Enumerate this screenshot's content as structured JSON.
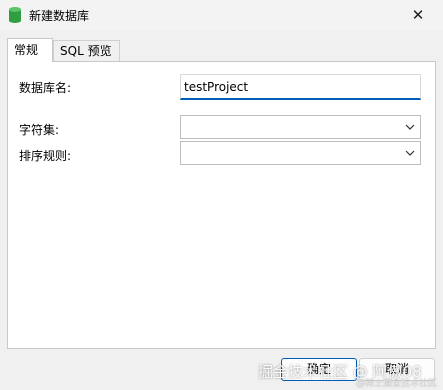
{
  "window": {
    "title": "新建数据库",
    "icon": "database-icon"
  },
  "tabs": [
    {
      "label": "常规",
      "active": true
    },
    {
      "label": "SQL 预览",
      "active": false
    }
  ],
  "form": {
    "db_name_label": "数据库名:",
    "db_name_value": "testProject",
    "charset_label": "字符集:",
    "charset_value": "",
    "collation_label": "排序规则:",
    "collation_value": ""
  },
  "buttons": {
    "ok": "确定",
    "cancel": "取消"
  },
  "watermark": {
    "main": "掘金技术社区 @ 阿傲08",
    "sub": "@稀土掘金技术社区"
  },
  "colors": {
    "accent": "#005fb8",
    "db_icon": "#2e9e3e"
  }
}
